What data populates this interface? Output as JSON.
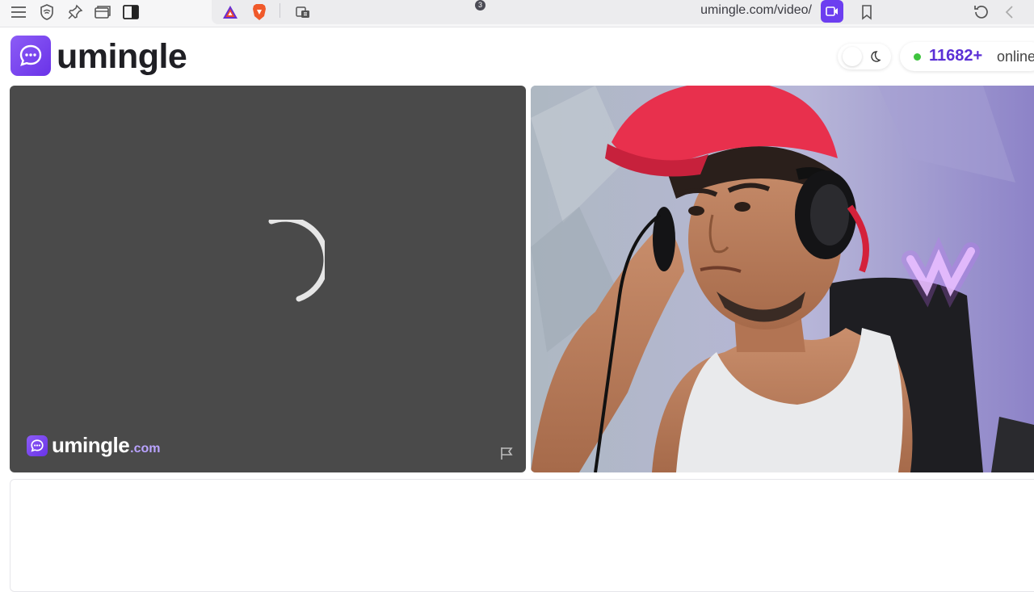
{
  "browser": {
    "url": "umingle.com/video/",
    "brave_badge_count": "3",
    "icons": [
      "menu-icon",
      "shield-icon",
      "pin-icon",
      "tabs-icon",
      "sidebar-icon",
      "brave-rewards-icon",
      "brave-shields-icon",
      "extension-icon",
      "video-camera-icon",
      "bookmark-icon",
      "reload-icon",
      "back-icon"
    ]
  },
  "header": {
    "logo_text": "umingle",
    "online_count": "11682+",
    "online_label": "online",
    "accent_color": "#6a33e8"
  },
  "local_video": {
    "watermark_text": "umingle",
    "watermark_domain": ".com",
    "state": "loading"
  },
  "remote_video": {
    "description_icon": "person-video"
  }
}
